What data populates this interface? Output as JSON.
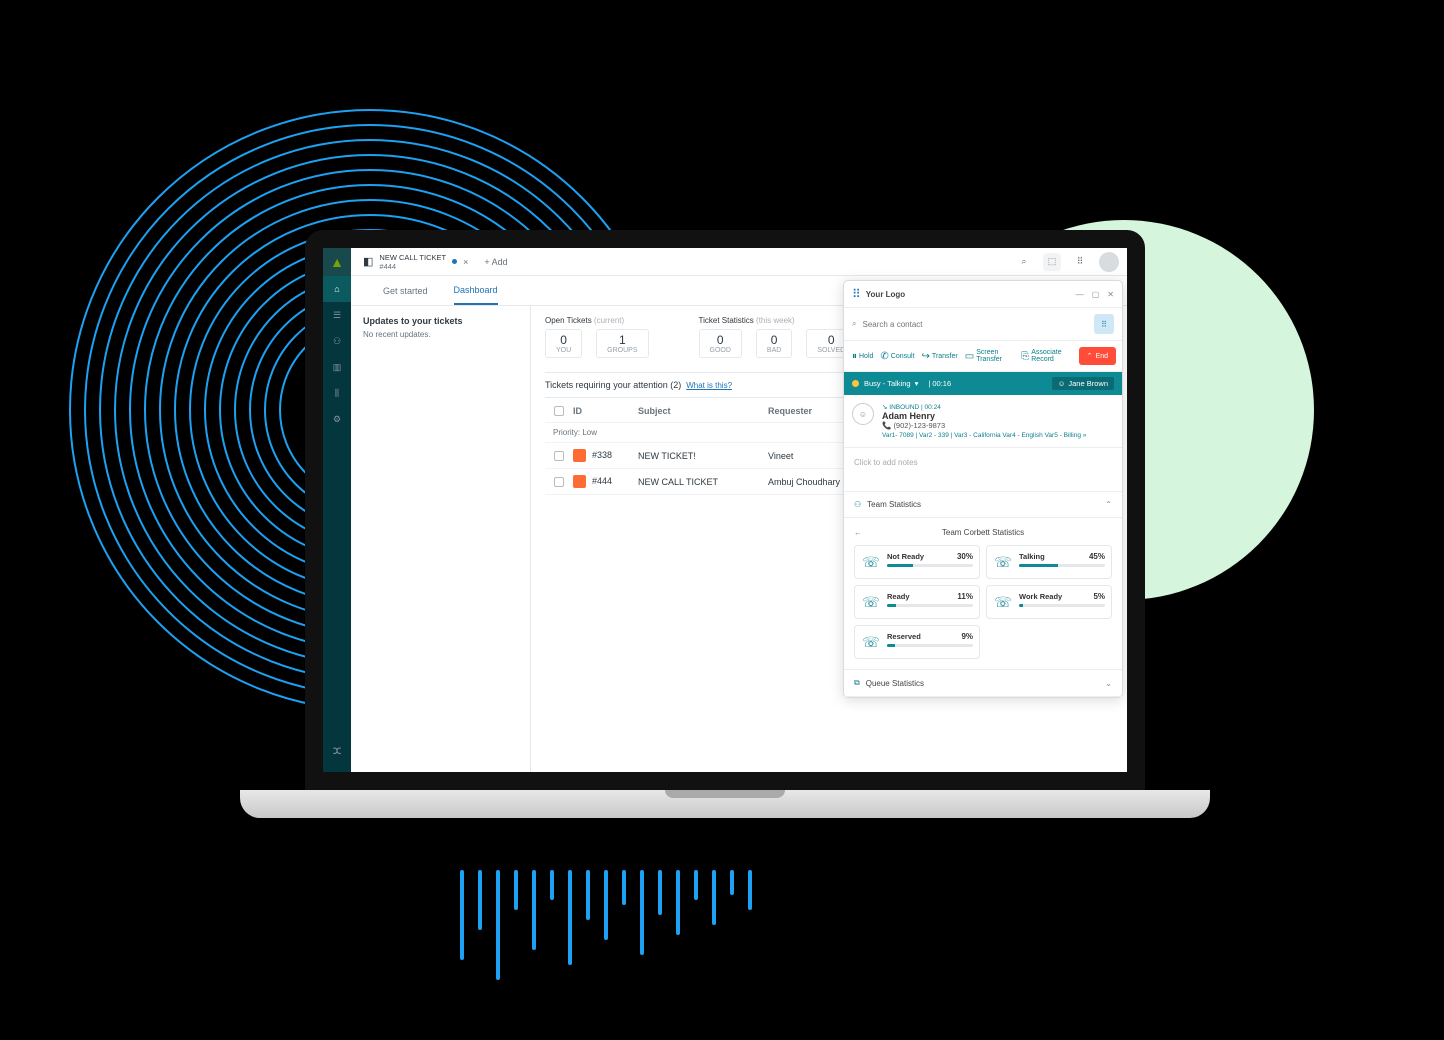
{
  "topbar": {
    "ticket_title": "NEW CALL TICKET",
    "ticket_id": "#444",
    "add_label": "+  Add"
  },
  "subnav": {
    "get_started": "Get started",
    "dashboard": "Dashboard"
  },
  "updates": {
    "title": "Updates to your tickets",
    "none": "No recent updates."
  },
  "stats": {
    "open": {
      "label": "Open Tickets",
      "paren": "(current)",
      "you_n": "0",
      "you_l": "YOU",
      "groups_n": "1",
      "groups_l": "GROUPS"
    },
    "ts": {
      "label": "Ticket Statistics",
      "paren": "(this week)",
      "good_n": "0",
      "good_l": "GOOD",
      "bad_n": "0",
      "bad_l": "BAD",
      "solved_n": "0",
      "solved_l": "SOLVED"
    }
  },
  "attention": {
    "label": "Tickets requiring your attention (2)",
    "help": "What is this?"
  },
  "table": {
    "hdr": {
      "id": "ID",
      "subject": "Subject",
      "requester": "Requester"
    },
    "priority": "Priority: Low",
    "rows": [
      {
        "id": "#338",
        "subject": "NEW TICKET!",
        "requester": "Vineet"
      },
      {
        "id": "#444",
        "subject": "NEW CALL TICKET",
        "requester": "Ambuj Choudhary"
      }
    ]
  },
  "panel": {
    "logo": "Your Logo",
    "search_ph": "Search a contact",
    "actions": {
      "hold": "Hold",
      "consult": "Consult",
      "transfer": "Transfer",
      "screen": "Screen Transfer",
      "assoc": "Associate Record",
      "end": "End"
    },
    "status": {
      "state": "Busy - Talking",
      "time": "| 00:16",
      "agent": "Jane Brown"
    },
    "caller": {
      "inbound": "INBOUND  |  00:24",
      "name": "Adam Henry",
      "phone": "(902)-123-9873",
      "vars": "Var1- 7089 | Var2 - 339 | Var3 - California  Var4 - English  Var5 - Billing »"
    },
    "notes": "Click to add notes",
    "team_sect": "Team Statistics",
    "team_title": "Team Corbett Statistics",
    "team": [
      {
        "label": "Not Ready",
        "pct": "30%",
        "w": 30
      },
      {
        "label": "Talking",
        "pct": "45%",
        "w": 45
      },
      {
        "label": "Ready",
        "pct": "11%",
        "w": 11
      },
      {
        "label": "Work Ready",
        "pct": "5%",
        "w": 5
      },
      {
        "label": "Reserved",
        "pct": "9%",
        "w": 9
      }
    ],
    "queue_sect": "Queue Statistics"
  }
}
